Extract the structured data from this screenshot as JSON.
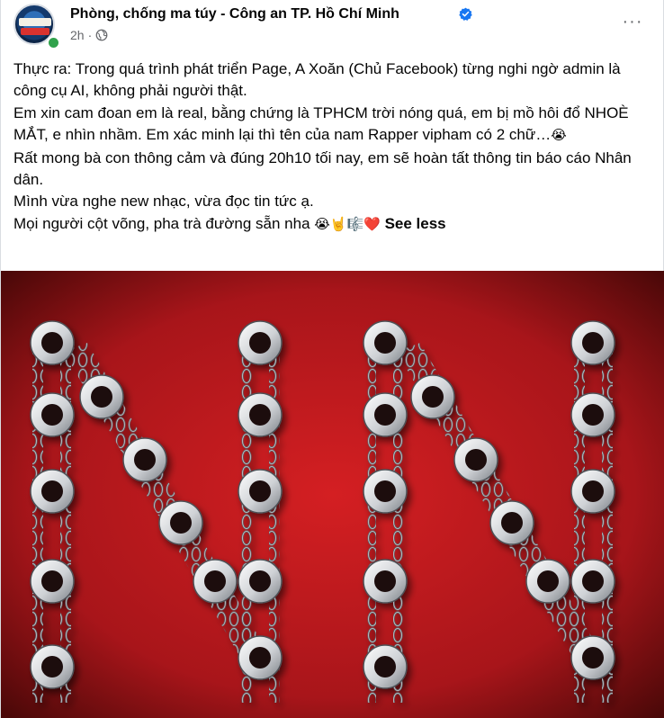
{
  "post": {
    "page_name": "Phòng, chống ma túy - Công an TP. Hồ Chí Minh",
    "timestamp": "2h",
    "privacy_icon": "globe-icon",
    "verified_icon": "verified-badge-icon",
    "more_icon": "more-options-icon",
    "more_label": "···",
    "text_lines": [
      "Thực ra: Trong quá trình phát triển Page, A Xoăn (Chủ Facebook) từng nghi ngờ admin là công cụ AI, không phải người thật.",
      "Em xin cam đoan em là real, bằng chứng là TPHCM trời nóng quá, em bị mồ hôi đổ NHOÈ MẮT, e nhìn nhầm. Em xác minh lại thì tên của nam Rapper vipham có 2 chữ…",
      "Rất mong bà con thông cảm và đúng 20h10 tối nay, em sẽ hoàn tất thông tin báo cáo Nhân dân.",
      "Mình vừa nghe new nhạc, vừa đọc tin tức ạ.",
      "Mọi người cột võng, pha trà đường sẵn nha"
    ],
    "emoji_line2": "😭",
    "emoji_line5": "😭🤘🎼❤️",
    "see_less_label": "See less",
    "image_icon": "handcuff-chain-letters-image",
    "colors": {
      "accent": "#1877f2",
      "meta": "#65676b",
      "image_red": "#b3121c",
      "online": "#31a24c"
    }
  }
}
